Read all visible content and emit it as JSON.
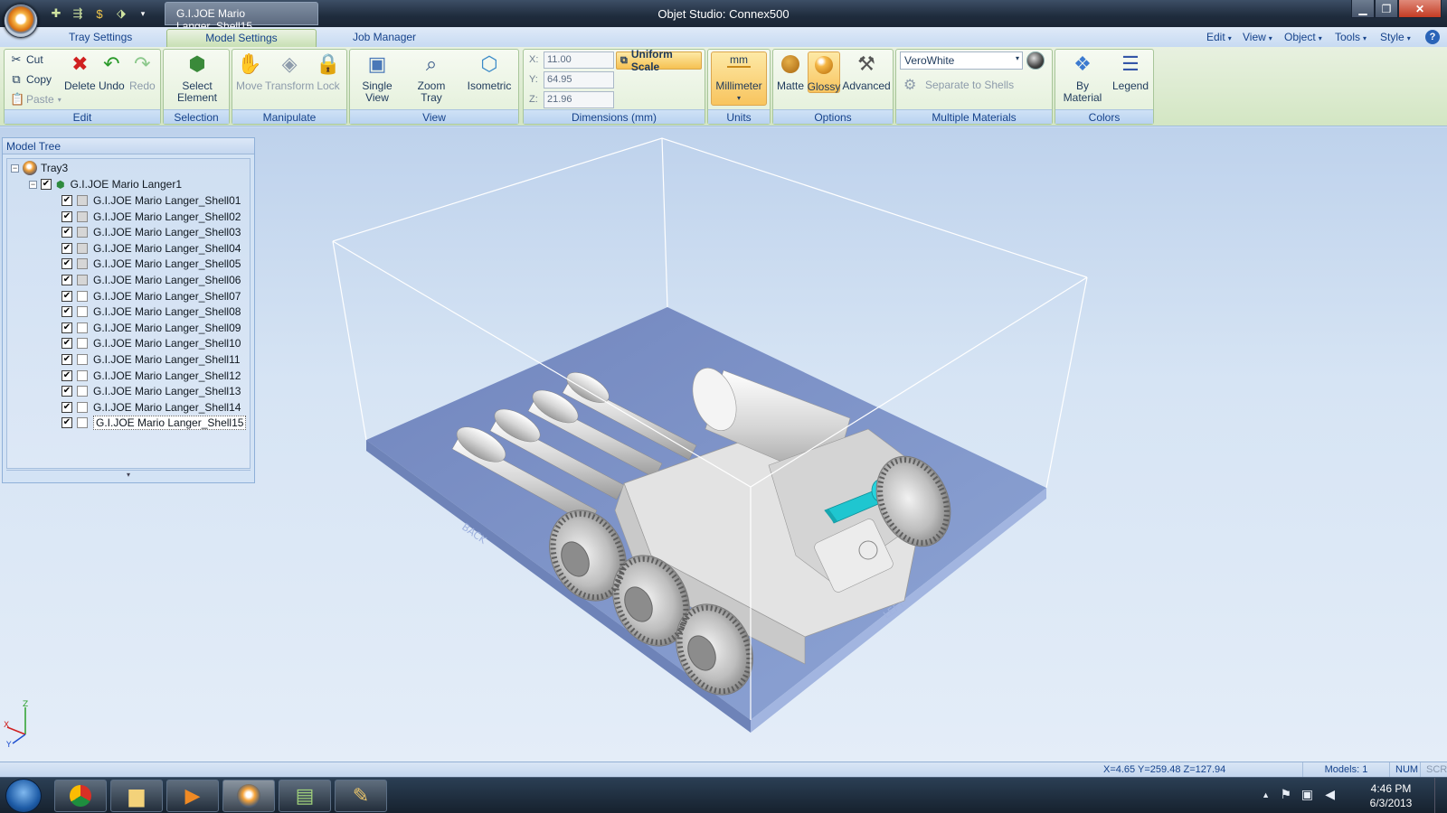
{
  "window": {
    "document_tab": "G.I.JOE Mario Langer_Shell15",
    "title": "Objet Studio: Connex500",
    "controls": {
      "minimize": "▁",
      "maximize": "❐",
      "close": "✕"
    }
  },
  "qat_icons": [
    "add-model-icon",
    "auto-place-icon",
    "cost-icon",
    "build-icon",
    "dropdown-icon"
  ],
  "tabs": [
    {
      "label": "Tray Settings"
    },
    {
      "label": "Model Settings"
    },
    {
      "label": "Job Manager"
    }
  ],
  "menus": [
    {
      "label": "Edit"
    },
    {
      "label": "View"
    },
    {
      "label": "Object"
    },
    {
      "label": "Tools"
    },
    {
      "label": "Style"
    }
  ],
  "help_icon": "?",
  "ribbon": {
    "edit": {
      "caption": "Edit",
      "cut": "Cut",
      "copy": "Copy",
      "paste": "Paste",
      "delete": "Delete",
      "undo": "Undo",
      "redo": "Redo"
    },
    "selection": {
      "caption": "Selection",
      "select_element": "Select\nElement"
    },
    "manipulate": {
      "caption": "Manipulate",
      "move": "Move",
      "transform": "Transform",
      "lock": "Lock"
    },
    "view": {
      "caption": "View",
      "single_view": "Single\nView",
      "zoom_tray": "Zoom\nTray",
      "isometric": "Isometric"
    },
    "dimensions": {
      "caption": "Dimensions (mm)",
      "x_label": "X:",
      "y_label": "Y:",
      "z_label": "Z:",
      "x": "11.00",
      "y": "64.95",
      "z": "21.96",
      "uniform_scale": "Uniform Scale"
    },
    "units": {
      "caption": "Units",
      "unit_symbol": "mm",
      "unit": "Millimeter"
    },
    "options": {
      "caption": "Options",
      "matte": "Matte",
      "glossy": "Glossy",
      "advanced": "Advanced"
    },
    "multiple_materials": {
      "caption": "Multiple Materials",
      "material": "VeroWhite",
      "separate": "Separate to Shells"
    },
    "colors": {
      "caption": "Colors",
      "by_material": "By\nMaterial",
      "legend": "Legend"
    }
  },
  "model_tree": {
    "title": "Model Tree",
    "tray": "Tray3",
    "model": "G.I.JOE Mario Langer1",
    "shells": [
      "G.I.JOE Mario Langer_Shell01",
      "G.I.JOE Mario Langer_Shell02",
      "G.I.JOE Mario Langer_Shell03",
      "G.I.JOE Mario Langer_Shell04",
      "G.I.JOE Mario Langer_Shell05",
      "G.I.JOE Mario Langer_Shell06",
      "G.I.JOE Mario Langer_Shell07",
      "G.I.JOE Mario Langer_Shell08",
      "G.I.JOE Mario Langer_Shell09",
      "G.I.JOE Mario Langer_Shell10",
      "G.I.JOE Mario Langer_Shell11",
      "G.I.JOE Mario Langer_Shell12",
      "G.I.JOE Mario Langer_Shell13",
      "G.I.JOE Mario Langer_Shell14",
      "G.I.JOE Mario Langer_Shell15"
    ],
    "selected_shell": "G.I.JOE Mario Langer_Shell15"
  },
  "axes": {
    "x": "X",
    "y": "Y",
    "z": "Z"
  },
  "status": {
    "coords": "X=4.65 Y=259.48 Z=127.94",
    "models": "Models: 1",
    "num": "NUM",
    "scrl": "SCRL"
  },
  "taskbar": {
    "apps": [
      "chrome-icon",
      "explorer-icon",
      "media-player-icon",
      "objet-studio-icon",
      "terminal-icon",
      "paint-icon"
    ],
    "time": "4:46 PM",
    "date": "6/3/2013"
  },
  "colors": {
    "ribbon_accent": "#15428b",
    "highlight": "#f8c45e",
    "selected_part": "#1fc6d0",
    "tray": "#7f95c9"
  }
}
